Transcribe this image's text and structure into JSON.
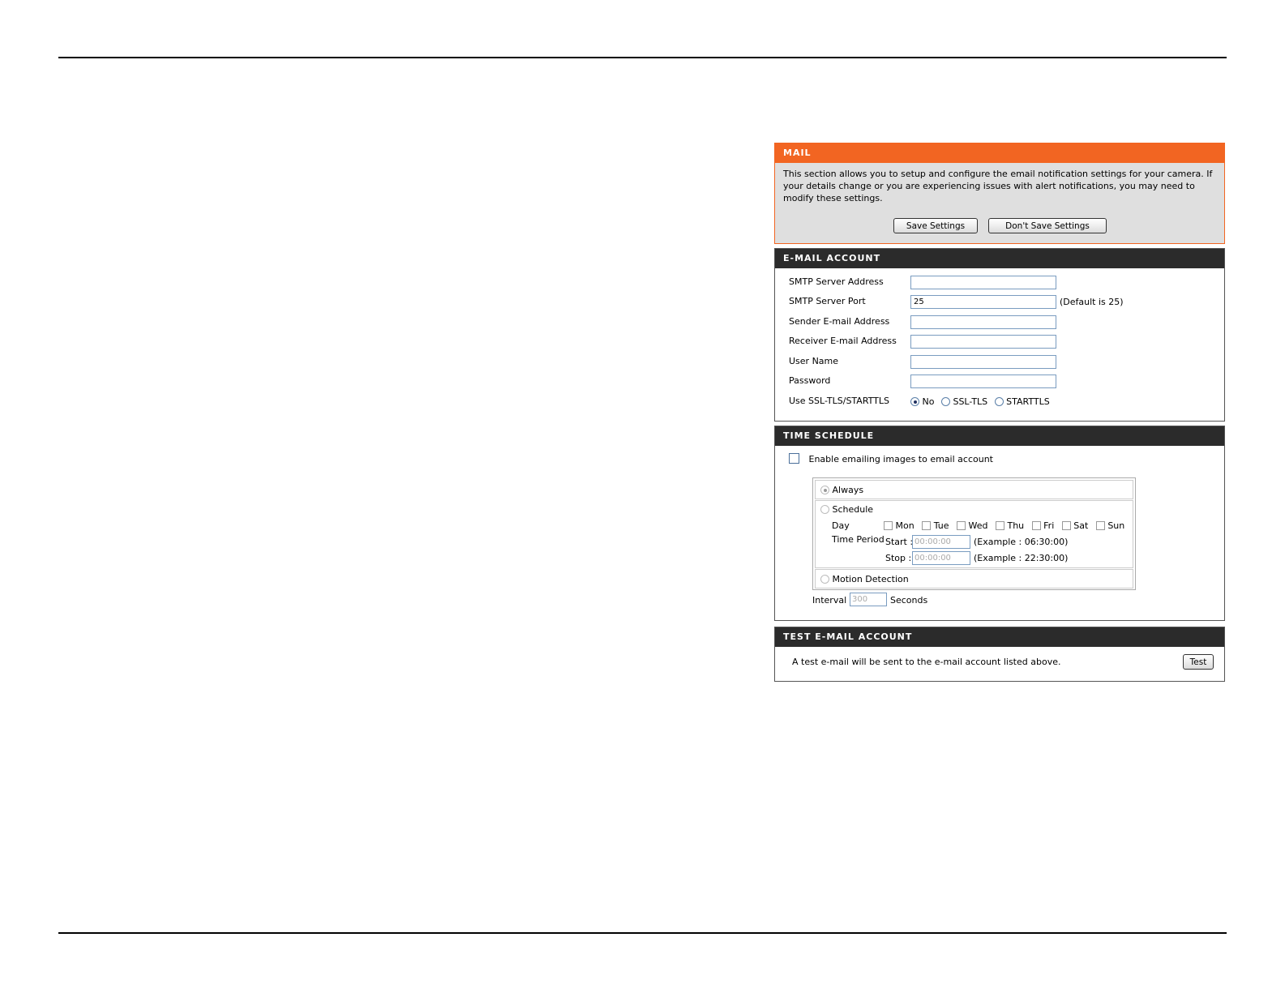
{
  "mail": {
    "title": "MAIL",
    "description": "This section allows you to setup and configure the email notification settings for your camera. If your details change or you are experiencing issues with alert notifications, you may need to modify these settings.",
    "save_label": "Save Settings",
    "dont_save_label": "Don't Save Settings"
  },
  "email_account": {
    "title": "E-MAIL ACCOUNT",
    "fields": [
      {
        "label": "SMTP Server Address",
        "value": ""
      },
      {
        "label": "SMTP Server Port",
        "value": "25",
        "note": "(Default is 25)"
      },
      {
        "label": "Sender E-mail Address",
        "value": ""
      },
      {
        "label": "Receiver E-mail Address",
        "value": ""
      },
      {
        "label": "User Name",
        "value": ""
      },
      {
        "label": "Password",
        "value": ""
      }
    ],
    "ssl_label": "Use SSL-TLS/STARTTLS",
    "ssl_options": [
      "No",
      "SSL-TLS",
      "STARTTLS"
    ],
    "ssl_selected": "No"
  },
  "time_schedule": {
    "title": "TIME SCHEDULE",
    "enable_label": "Enable emailing images to email account",
    "enable_checked": false,
    "always_label": "Always",
    "schedule_label": "Schedule",
    "day_label": "Day",
    "days": [
      "Mon",
      "Tue",
      "Wed",
      "Thu",
      "Fri",
      "Sat",
      "Sun"
    ],
    "time_period_label": "Time Period",
    "start_label": "Start :",
    "start_value": "00:00:00",
    "start_example": "(Example : 06:30:00)",
    "stop_label": "Stop :",
    "stop_value": "00:00:00",
    "stop_example": "(Example : 22:30:00)",
    "motion_label": "Motion Detection",
    "interval_label": "Interval",
    "interval_value": "300",
    "seconds_label": "Seconds"
  },
  "test_account": {
    "title": "TEST E-MAIL ACCOUNT",
    "description": "A test e-mail will be sent to the e-mail account listed above.",
    "test_label": "Test"
  }
}
